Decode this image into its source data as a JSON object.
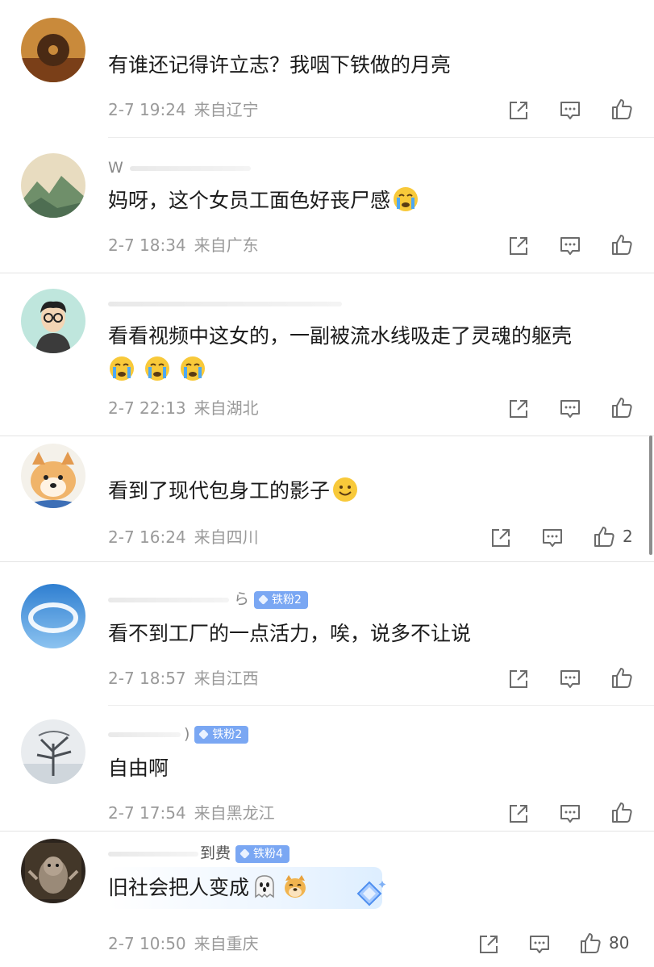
{
  "comments": [
    {
      "username": "",
      "badge": "",
      "text": "有谁还记得许立志？我咽下铁做的月亮",
      "emojis": [],
      "date": "2-7 19:24",
      "location": "来自辽宁",
      "likes": ""
    },
    {
      "username": "W",
      "badge": "",
      "text": "妈呀，这个女员工面色好丧尸感",
      "emojis": [
        "crying-face-emoji"
      ],
      "date": "2-7 18:34",
      "location": "来自广东",
      "likes": ""
    },
    {
      "username": "",
      "badge": "",
      "text": "看看视频中这女的，一副被流水线吸走了灵魂的躯壳",
      "emojis": [
        "crying-face-emoji",
        "crying-face-emoji",
        "crying-face-emoji"
      ],
      "date": "2-7 22:13",
      "location": "来自湖北",
      "likes": ""
    },
    {
      "username": "",
      "badge": "",
      "text": "看到了现代包身工的影子",
      "emojis": [
        "smile-face-emoji"
      ],
      "date": "2-7 16:24",
      "location": "来自四川",
      "likes": "2"
    },
    {
      "username": "ら",
      "badge": "铁粉2",
      "text": "看不到工厂的一点活力，唉，说多不让说",
      "emojis": [],
      "date": "2-7 18:57",
      "location": "来自江西",
      "likes": ""
    },
    {
      "username": ")",
      "badge": "铁粉2",
      "text": "自由啊",
      "emojis": [],
      "date": "2-7 17:54",
      "location": "来自黑龙江",
      "likes": ""
    },
    {
      "username": "到费",
      "badge": "铁粉4",
      "text": "旧社会把人变成",
      "emojis": [
        "ghost-emoji",
        "doge-emoji"
      ],
      "date": "2-7 10:50",
      "location": "来自重庆",
      "likes": "80"
    }
  ],
  "icons": {
    "share": "share-icon",
    "comment": "comment-icon",
    "like": "thumbs-up-icon"
  },
  "colors": {
    "badge": "#7aa7f3",
    "meta_text": "#9a9a9a",
    "icon": "#6b6b6b"
  }
}
